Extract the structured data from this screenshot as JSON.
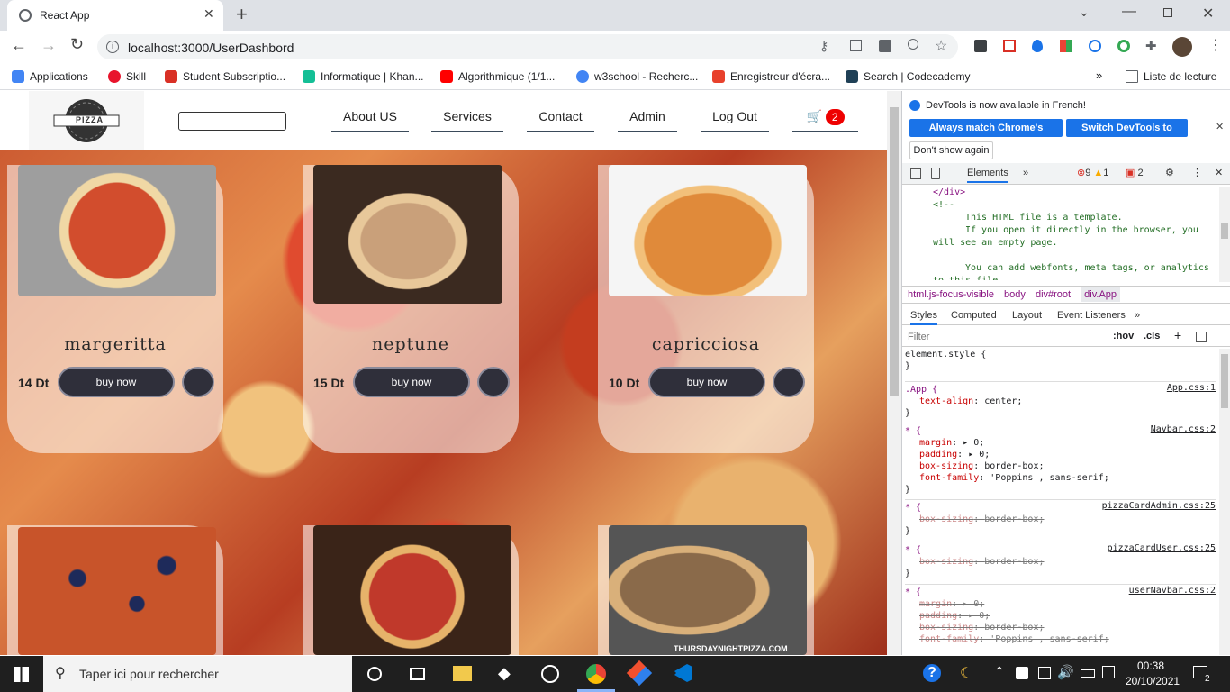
{
  "browser": {
    "tab_title": "React App",
    "url": "localhost:3000/UserDashbord",
    "bookmarks": [
      {
        "label": "Applications",
        "color": "#4285f4"
      },
      {
        "label": "Skill",
        "color": "#e8142c"
      },
      {
        "label": "Student Subscriptio...",
        "color": "#d93025"
      },
      {
        "label": "Informatique | Khan...",
        "color": "#14bf96"
      },
      {
        "label": "Algorithmique (1/1...",
        "color": "#ff0000"
      },
      {
        "label": "w3school - Recherc...",
        "color": "#4285f4"
      },
      {
        "label": "Enregistreur d'écra...",
        "color": "#e8412c"
      },
      {
        "label": "Search | Codecademy",
        "color": "#1f4056"
      }
    ],
    "reading_list": "Liste de lecture"
  },
  "navbar": {
    "logo_text": "PIZZA",
    "links": [
      "About US",
      "Services",
      "Contact",
      "Admin",
      "Log Out"
    ],
    "cart_count": "2"
  },
  "products": [
    {
      "name": "margeritta",
      "price": "14 Dt",
      "button": "buy now",
      "img": "#c8452b"
    },
    {
      "name": "neptune",
      "price": "15 Dt",
      "button": "buy now",
      "img": "#b98a62"
    },
    {
      "name": "capricciosa",
      "price": "10 Dt",
      "button": "buy now",
      "img": "#d9772f"
    },
    {
      "name": "",
      "price": "",
      "button": "",
      "img": "#c04b25"
    },
    {
      "name": "",
      "price": "",
      "button": "",
      "img": "#5a3a28"
    },
    {
      "name": "",
      "price": "",
      "button": "",
      "img": "#6b6b6b",
      "watermark": "THURSDAYNIGHTPIZZA.COM"
    }
  ],
  "devtools": {
    "notice": "DevTools is now available in French!",
    "btn_match": "Always match Chrome's language",
    "btn_switch": "Switch DevTools to French",
    "btn_dont": "Don't show again",
    "tab_elements": "Elements",
    "errors": "9",
    "warnings": "1",
    "issues": "2",
    "html_lines": [
      "</div>",
      "<!--",
      "This HTML file is a template.",
      "If you open it directly in the browser, you",
      "will see an empty page.",
      "You can add webfonts, meta tags, or analytics",
      "to this file."
    ],
    "breadcrumbs": [
      "html.js-focus-visible",
      "body",
      "div#root",
      "div.App"
    ],
    "subtabs": [
      "Styles",
      "Computed",
      "Layout",
      "Event Listeners"
    ],
    "filter_placeholder": "Filter",
    "hov": ":hov",
    "cls": ".cls",
    "rules": [
      {
        "selector": "element.style {",
        "source": "",
        "props": []
      },
      {
        "selector": ".App {",
        "source": "App.css:1",
        "props": [
          {
            "k": "text-align",
            "v": "center;",
            "strike": false
          }
        ]
      },
      {
        "selector": "* {",
        "source": "Navbar.css:2",
        "props": [
          {
            "k": "margin",
            "v": "▸ 0;",
            "strike": false
          },
          {
            "k": "padding",
            "v": "▸ 0;",
            "strike": false
          },
          {
            "k": "box-sizing",
            "v": "border-box;",
            "strike": false
          },
          {
            "k": "font-family",
            "v": "'Poppins', sans-serif;",
            "strike": false
          }
        ]
      },
      {
        "selector": "* {",
        "source": "pizzaCardAdmin.css:25",
        "props": [
          {
            "k": "box-sizing",
            "v": "border-box;",
            "strike": true
          }
        ]
      },
      {
        "selector": "* {",
        "source": "pizzaCardUser.css:25",
        "props": [
          {
            "k": "box-sizing",
            "v": "border-box;",
            "strike": true
          }
        ]
      },
      {
        "selector": "* {",
        "source": "userNavbar.css:2",
        "props": [
          {
            "k": "margin",
            "v": "▸ 0;",
            "strike": true
          },
          {
            "k": "padding",
            "v": "▸ 0;",
            "strike": true
          },
          {
            "k": "box-sizing",
            "v": "border-box;",
            "strike": true
          },
          {
            "k": "font-family",
            "v": "'Poppins', sans-serif;",
            "strike": true
          }
        ]
      }
    ]
  },
  "taskbar": {
    "search_placeholder": "Taper ici pour rechercher",
    "time": "00:38",
    "date": "20/10/2021",
    "notifications": "2"
  }
}
